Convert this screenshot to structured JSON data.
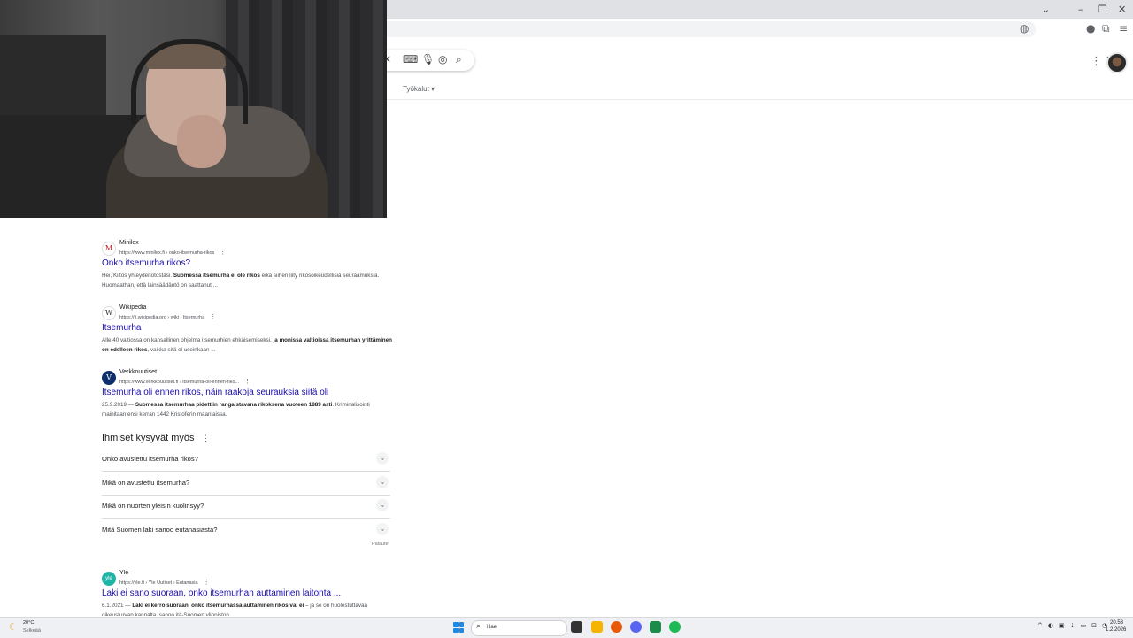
{
  "browser": {
    "window_controls": {
      "chevron": "⌄",
      "minimize": "–",
      "restore": "❐",
      "close": "✕"
    },
    "address_icons": [
      "translate-icon",
      "extension-icon",
      "profile-icon",
      "menu-icon"
    ]
  },
  "search": {
    "clear_glyph": "✕",
    "tools_label": "Työkalut"
  },
  "results": [
    {
      "favicon": "M",
      "site": "Minilex",
      "url": "https://www.minilex.fi › onko-itsemurha-rikos",
      "title": "Onko itsemurha rikos?",
      "snippet_plain_1": "Hei, Kiitos yhteydenotostasi. ",
      "snippet_bold_1": "Suomessa itsemurha ei ole rikos",
      "snippet_plain_2": " eikä siihen liity rikosoikeudellisia seuraamuksia. Huomaathan, että lainsäädäntö on saattanut ..."
    },
    {
      "favicon": "W",
      "site": "Wikipedia",
      "url": "https://fi.wikipedia.org › wiki › Itsemurha",
      "title": "Itsemurha",
      "snippet_plain_1": "Alle 40 valtiossa on kansallinen ohjelma itsemurhien ehkäisemiseksi. ",
      "snippet_bold_1": "ja monissa valtioissa itsemurhan yrittäminen on edelleen rikos",
      "snippet_plain_2": ", vaikka sitä ei useinkaan ..."
    },
    {
      "favicon": "V",
      "site": "Verkkouutiset",
      "url": "https://www.verkkouutiset.fi › itsemurha-oli-ennen-riko...",
      "title": "Itsemurha oli ennen rikos, näin raakoja seurauksia siitä oli",
      "snippet_plain_1": "25.9.2019 — ",
      "snippet_bold_1": "Suomessa itsemurhaa pidettiin rangaistavana rikoksena vuoteen 1889 asti",
      "snippet_plain_2": ". Kriminalisointi mainitaan ensi kerran 1442 Kristoferin maanlaissa."
    }
  ],
  "people_also_ask": {
    "title": "Ihmiset kysyvät myös",
    "questions": [
      "Onko avustettu itsemurha rikos?",
      "Mikä on avustettu itsemurha?",
      "Mikä on nuorten yleisin kuolinsyy?",
      "Mitä Suomen laki sanoo eutanasiasta?"
    ],
    "feedback": "Palaute"
  },
  "yle_result": {
    "favicon": "yle",
    "site": "Yle",
    "url": "https://yle.fi › Yle Uutiset › Eutanasia",
    "title": "Laki ei sano suoraan, onko itsemurhan auttaminen laitonta ...",
    "snippet_plain_1": "6.1.2021 — ",
    "snippet_bold_1": "Laki ei kerro suoraan, onko itsemurhassa auttaminen rikos vai ei",
    "snippet_plain_2": " – ja se on huolestuttavaa oikeusturvan kannalta, sanoo itä-Suomen yliopiston ..."
  },
  "taskbar": {
    "weather_temp": "20°C",
    "weather_desc": "Selkeää",
    "search_placeholder": "Hae",
    "clock_time": "20.53",
    "clock_date": "1.2.2026",
    "colors": {
      "start": "#1e88e5",
      "explorer": "#f4b400",
      "firefox": "#e8590c",
      "discord": "#5865f2",
      "whatsapp": "#1b8c4a",
      "spotify": "#1db954"
    }
  }
}
